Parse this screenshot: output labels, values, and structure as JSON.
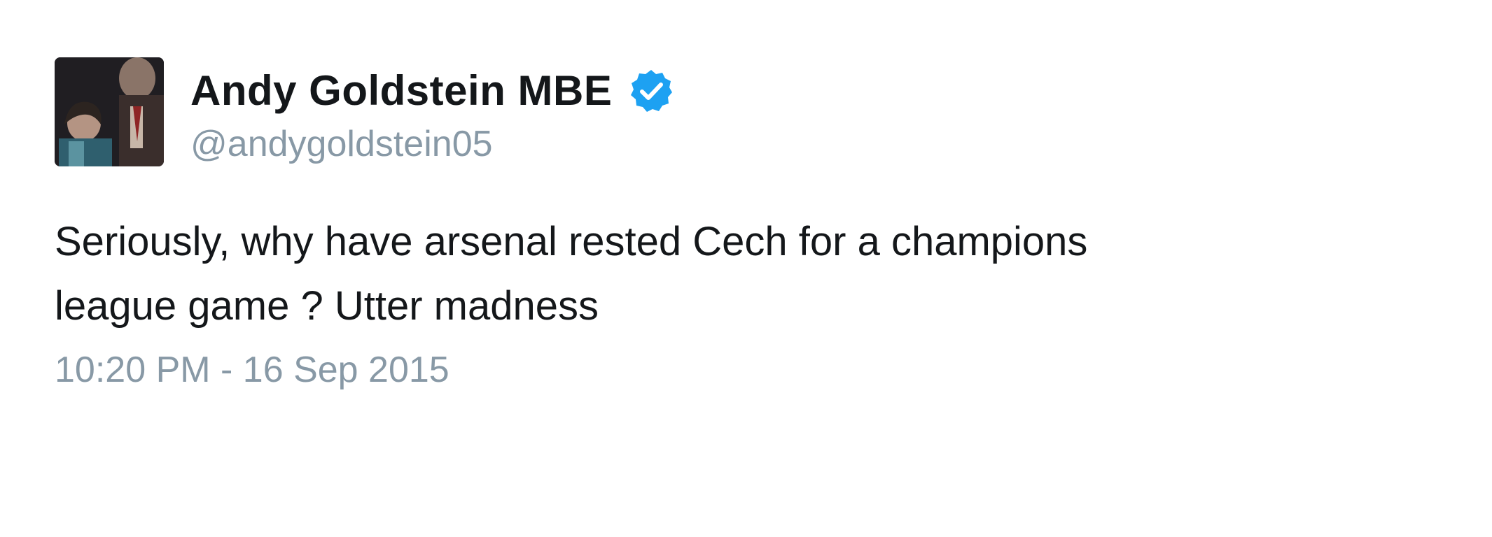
{
  "tweet": {
    "author": {
      "display_name": "Andy Goldstein MBE",
      "handle": "@andygoldstein05",
      "verified": true,
      "avatar_icon": "profile-photo"
    },
    "text": "Seriously, why have arsenal rested Cech for a champions\nleague game ? Utter madness",
    "timestamp": "10:20 PM - 16 Sep 2015"
  },
  "colors": {
    "text_primary": "#14171a",
    "text_secondary": "#8899a6",
    "verified_badge": "#1da1f2",
    "background": "#ffffff"
  }
}
